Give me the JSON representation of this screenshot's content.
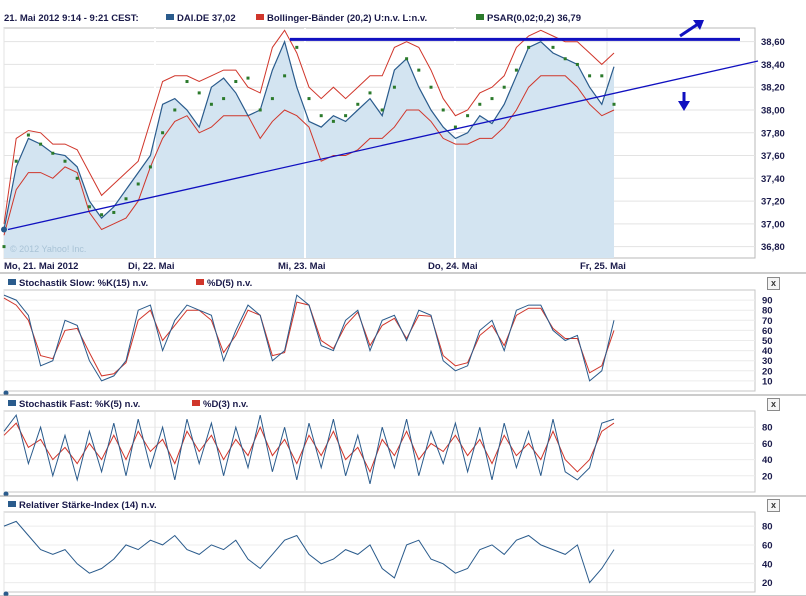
{
  "header": {
    "time_range": "21. Mai 2012 9:14 - 9:21 CEST:",
    "instrument": "DAI.DE 37,02",
    "bollinger": "Bollinger-Bänder (20,2) U:n.v. L:n.v.",
    "psar": "PSAR(0,02;0,2) 36,79"
  },
  "watermark": "© 2012 Yahoo! Inc.",
  "panels": {
    "stoch_slow": {
      "k_label": "Stochastik Slow:  %K(15) n.v.",
      "d_label": "%D(5) n.v."
    },
    "stoch_fast": {
      "k_label": "Stochastik Fast:  %K(5) n.v.",
      "d_label": "%D(3) n.v."
    },
    "rsi": {
      "label": "Relativer Stärke-Index (14) n.v."
    },
    "close_glyph": "x"
  },
  "colors": {
    "price": "#2a5b8c",
    "fill": "#d3e4f1",
    "bollinger": "#d0362b",
    "psar": "#2b7a2b",
    "trend": "#1010c0"
  },
  "chart_data": [
    {
      "type": "line",
      "title": "DAI.DE",
      "xlabel": "",
      "ylabel": "",
      "x_ticks": [
        "Mo, 21. Mai 2012",
        "Di, 22. Mai",
        "Mi, 23. Mai",
        "Do, 24. Mai",
        "Fr, 25. Mai"
      ],
      "y_ticks": [
        "36,80",
        "37,00",
        "37,20",
        "37,40",
        "37,60",
        "37,80",
        "38,00",
        "38,20",
        "38,40",
        "38,60"
      ],
      "ylim": [
        36.7,
        38.72
      ],
      "x": [
        0,
        2,
        4,
        6,
        8,
        10,
        12,
        14,
        16,
        18,
        20,
        22,
        24,
        26,
        28,
        30,
        32,
        34,
        36,
        38,
        40,
        42,
        44,
        46,
        48,
        50,
        52,
        54,
        56,
        58,
        60,
        62,
        64,
        66,
        68,
        70,
        72,
        74,
        76,
        78,
        80,
        82,
        84,
        86,
        88,
        90,
        92,
        94,
        96,
        98,
        100
      ],
      "series": [
        {
          "name": "DAI.DE",
          "values": [
            36.95,
            37.5,
            37.75,
            37.7,
            37.62,
            37.6,
            37.5,
            37.2,
            37.05,
            37.15,
            37.3,
            37.45,
            37.6,
            38.05,
            38.1,
            38.0,
            37.85,
            38.2,
            38.28,
            38.15,
            37.95,
            38.0,
            38.35,
            38.6,
            38.2,
            37.9,
            37.85,
            37.95,
            37.9,
            38.0,
            38.1,
            37.95,
            38.35,
            38.45,
            38.2,
            38.0,
            37.85,
            37.75,
            37.8,
            37.95,
            37.88,
            38.05,
            38.3,
            38.55,
            38.6,
            38.5,
            38.45,
            38.4,
            38.2,
            38.05,
            38.38
          ]
        },
        {
          "name": "Bollinger-Bänder (20,2)",
          "values": [
            36.9,
            37.3,
            37.45,
            37.45,
            37.4,
            37.5,
            37.45,
            37.1,
            36.95,
            37.0,
            37.05,
            37.2,
            37.5,
            37.75,
            37.9,
            37.95,
            37.8,
            37.85,
            37.95,
            37.95,
            37.95,
            37.75,
            37.9,
            38.0,
            37.95,
            37.85,
            37.55,
            37.6,
            37.6,
            37.65,
            37.75,
            37.75,
            37.85,
            38.0,
            38.0,
            37.9,
            37.75,
            37.7,
            37.7,
            37.75,
            37.75,
            37.85,
            38.0,
            38.2,
            38.3,
            38.3,
            38.3,
            38.2,
            38.05,
            37.95,
            38.0
          ]
        },
        {
          "name": "Bollinger upper",
          "values": [
            37.0,
            37.75,
            37.82,
            37.8,
            37.7,
            37.7,
            37.65,
            37.45,
            37.25,
            37.35,
            37.45,
            37.55,
            37.9,
            38.25,
            38.3,
            38.3,
            38.25,
            38.3,
            38.35,
            38.35,
            38.2,
            38.15,
            38.55,
            38.7,
            38.5,
            38.2,
            38.1,
            38.2,
            38.1,
            38.2,
            38.3,
            38.3,
            38.55,
            38.6,
            38.55,
            38.35,
            38.1,
            37.95,
            38.0,
            38.15,
            38.2,
            38.3,
            38.55,
            38.65,
            38.7,
            38.65,
            38.6,
            38.6,
            38.5,
            38.4,
            38.5
          ]
        },
        {
          "name": "PSAR",
          "values": [
            36.8,
            37.55,
            37.78,
            37.7,
            37.62,
            37.55,
            37.4,
            37.15,
            37.08,
            37.1,
            37.22,
            37.35,
            37.5,
            37.8,
            38.0,
            38.25,
            38.15,
            38.05,
            38.1,
            38.25,
            38.28,
            38.0,
            38.1,
            38.3,
            38.55,
            38.1,
            37.95,
            37.9,
            37.95,
            38.05,
            38.15,
            38.0,
            38.2,
            38.45,
            38.35,
            38.2,
            38.0,
            37.85,
            37.95,
            38.05,
            38.1,
            38.2,
            38.35,
            38.55,
            38.62,
            38.55,
            38.45,
            38.4,
            38.3,
            38.3,
            38.05
          ]
        }
      ],
      "annotations": [
        "resistance line at 38,62",
        "rising trend line",
        "arrow up",
        "arrow down"
      ]
    },
    {
      "type": "line",
      "title": "Stochastik Slow",
      "y_ticks": [
        "10",
        "20",
        "30",
        "40",
        "50",
        "60",
        "70",
        "80",
        "90"
      ],
      "ylim": [
        0,
        100
      ],
      "x": [
        0,
        2,
        4,
        6,
        8,
        10,
        12,
        14,
        16,
        18,
        20,
        22,
        24,
        26,
        28,
        30,
        32,
        34,
        36,
        38,
        40,
        42,
        44,
        46,
        48,
        50,
        52,
        54,
        56,
        58,
        60,
        62,
        64,
        66,
        68,
        70,
        72,
        74,
        76,
        78,
        80,
        82,
        84,
        86,
        88,
        90,
        92,
        94,
        96,
        98,
        100
      ],
      "series": [
        {
          "name": "%K(15)",
          "values": [
            95,
            90,
            75,
            25,
            30,
            70,
            65,
            30,
            10,
            15,
            30,
            80,
            85,
            40,
            70,
            85,
            80,
            75,
            30,
            60,
            85,
            75,
            30,
            40,
            95,
            85,
            45,
            40,
            70,
            80,
            40,
            70,
            75,
            50,
            80,
            75,
            30,
            20,
            25,
            60,
            70,
            40,
            80,
            85,
            85,
            60,
            50,
            55,
            10,
            20,
            70
          ]
        },
        {
          "name": "%D(5)",
          "values": [
            92,
            85,
            70,
            35,
            32,
            60,
            62,
            38,
            15,
            17,
            28,
            70,
            80,
            50,
            65,
            80,
            80,
            70,
            38,
            55,
            80,
            75,
            35,
            38,
            88,
            85,
            50,
            42,
            65,
            78,
            45,
            65,
            72,
            52,
            75,
            74,
            35,
            25,
            28,
            55,
            65,
            45,
            75,
            82,
            82,
            62,
            52,
            52,
            18,
            25,
            60
          ]
        }
      ]
    },
    {
      "type": "line",
      "title": "Stochastik Fast",
      "y_ticks": [
        "20",
        "40",
        "60",
        "80"
      ],
      "ylim": [
        0,
        100
      ],
      "x": [
        0,
        2,
        4,
        6,
        8,
        10,
        12,
        14,
        16,
        18,
        20,
        22,
        24,
        26,
        28,
        30,
        32,
        34,
        36,
        38,
        40,
        42,
        44,
        46,
        48,
        50,
        52,
        54,
        56,
        58,
        60,
        62,
        64,
        66,
        68,
        70,
        72,
        74,
        76,
        78,
        80,
        82,
        84,
        86,
        88,
        90,
        92,
        94,
        96,
        98,
        100
      ],
      "series": [
        {
          "name": "%K(5)",
          "values": [
            75,
            95,
            35,
            80,
            20,
            70,
            15,
            75,
            25,
            85,
            20,
            90,
            30,
            80,
            15,
            90,
            35,
            85,
            20,
            80,
            30,
            95,
            25,
            80,
            15,
            85,
            30,
            90,
            20,
            70,
            10,
            80,
            30,
            90,
            20,
            75,
            35,
            85,
            25,
            80,
            15,
            85,
            30,
            75,
            20,
            90,
            25,
            15,
            30,
            85,
            90
          ]
        },
        {
          "name": "%D(3)",
          "values": [
            70,
            85,
            55,
            65,
            40,
            55,
            35,
            60,
            40,
            70,
            40,
            75,
            50,
            65,
            35,
            75,
            50,
            70,
            40,
            65,
            45,
            80,
            45,
            65,
            35,
            70,
            45,
            75,
            40,
            55,
            25,
            65,
            45,
            75,
            40,
            60,
            50,
            70,
            45,
            65,
            35,
            70,
            45,
            60,
            40,
            75,
            40,
            25,
            40,
            75,
            85
          ]
        }
      ]
    },
    {
      "type": "line",
      "title": "Relativer Stärke-Index",
      "y_ticks": [
        "20",
        "40",
        "60",
        "80"
      ],
      "ylim": [
        10,
        95
      ],
      "x": [
        0,
        2,
        4,
        6,
        8,
        10,
        12,
        14,
        16,
        18,
        20,
        22,
        24,
        26,
        28,
        30,
        32,
        34,
        36,
        38,
        40,
        42,
        44,
        46,
        48,
        50,
        52,
        54,
        56,
        58,
        60,
        62,
        64,
        66,
        68,
        70,
        72,
        74,
        76,
        78,
        80,
        82,
        84,
        86,
        88,
        90,
        92,
        94,
        96,
        98,
        100
      ],
      "series": [
        {
          "name": "RSI(14)",
          "values": [
            80,
            85,
            70,
            55,
            50,
            55,
            40,
            30,
            35,
            45,
            60,
            55,
            65,
            60,
            70,
            55,
            50,
            60,
            55,
            65,
            45,
            35,
            50,
            65,
            70,
            50,
            40,
            45,
            55,
            50,
            60,
            35,
            25,
            60,
            65,
            45,
            40,
            30,
            35,
            55,
            60,
            50,
            65,
            70,
            60,
            55,
            50,
            60,
            20,
            35,
            55
          ]
        }
      ]
    }
  ]
}
